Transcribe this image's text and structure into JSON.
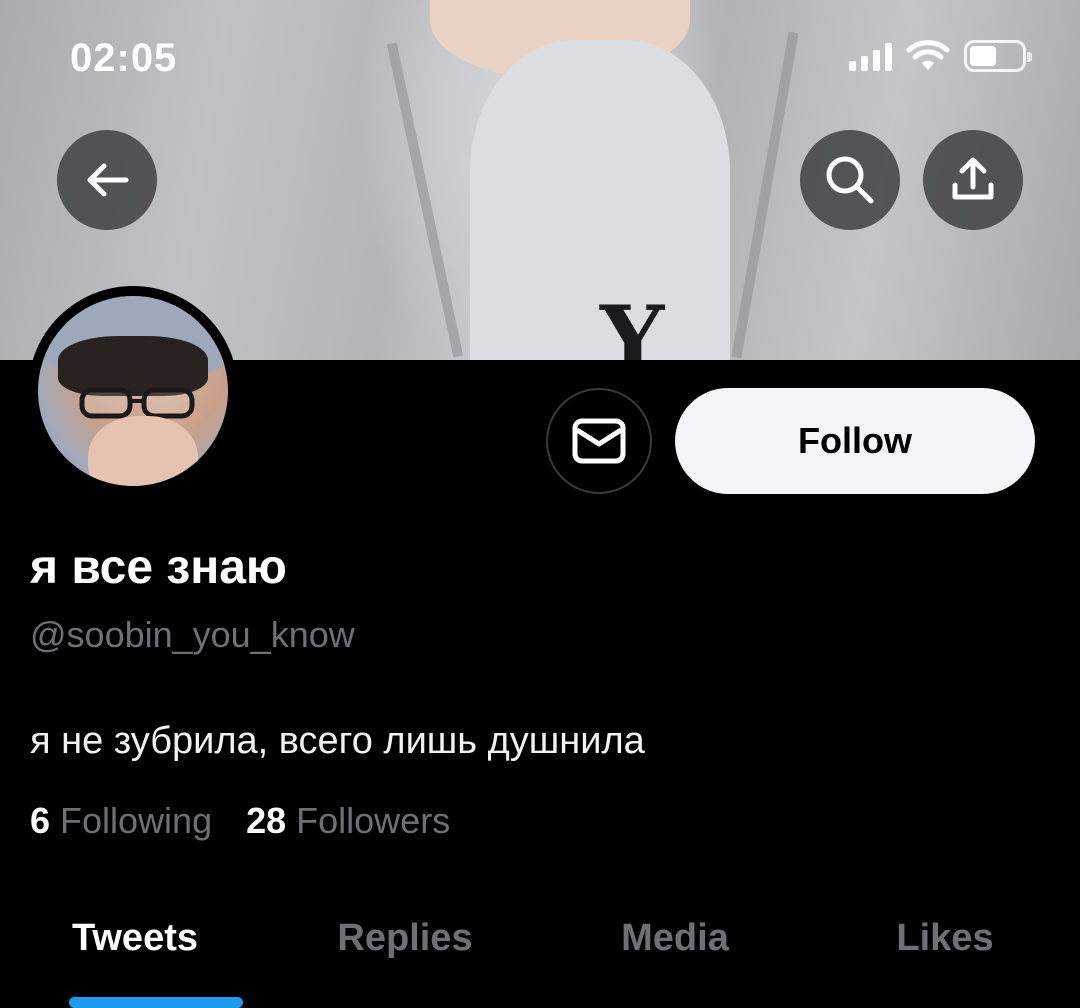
{
  "status_bar": {
    "time": "02:05"
  },
  "profile": {
    "display_name": "я все знаю",
    "handle": "@soobin_you_know",
    "bio": "я не зубрила, всего лишь душнила",
    "following_count": "6",
    "following_label": "Following",
    "followers_count": "28",
    "followers_label": "Followers"
  },
  "actions": {
    "follow_label": "Follow"
  },
  "banner": {
    "shirt_text": "Y"
  },
  "tabs": [
    {
      "label": "Tweets",
      "active": true
    },
    {
      "label": "Replies",
      "active": false
    },
    {
      "label": "Media",
      "active": false
    },
    {
      "label": "Likes",
      "active": false
    }
  ],
  "icons": {
    "back": "arrow-left-icon",
    "search": "search-icon",
    "share": "share-icon",
    "message": "envelope-icon"
  },
  "colors": {
    "accent": "#1d9bf0",
    "muted": "#6e7075",
    "background": "#000000"
  }
}
